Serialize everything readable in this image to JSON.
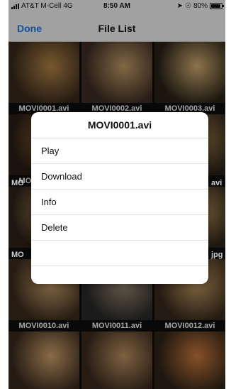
{
  "status_bar": {
    "carrier": "AT&T M-Cell",
    "network": "4G",
    "time": "8:50 AM",
    "battery": "80%"
  },
  "nav": {
    "done_label": "Done",
    "title": "File List"
  },
  "files": [
    {
      "label": "MOVI0001.avi",
      "tone": [
        "#3b2a1c",
        "#b7884a"
      ]
    },
    {
      "label": "MOVI0002.avi",
      "tone": [
        "#3f2e24",
        "#c79f6a"
      ]
    },
    {
      "label": "MOVI0003.avi",
      "tone": [
        "#2a2418",
        "#d7b176"
      ]
    },
    {
      "label": "MOVI0004.avi",
      "tone": [
        "#2a1e14",
        "#9a6d3d"
      ]
    },
    {
      "label": "",
      "tone": [
        "#241a12",
        "#8a6a46"
      ]
    },
    {
      "label": "",
      "tone": [
        "#2a2217",
        "#a48150"
      ]
    },
    {
      "label": "",
      "tone": [
        "#2f2318",
        "#b28a57"
      ]
    },
    {
      "label": "",
      "tone": [
        "#2a2218",
        "#9a7a52"
      ]
    },
    {
      "label": "",
      "tone": [
        "#2c2419",
        "#c3985d"
      ]
    },
    {
      "label": "MOVI0010.avi",
      "tone": [
        "#3b2b1d",
        "#caa16a"
      ]
    },
    {
      "label": "MOVI0011.avi",
      "tone": [
        "#2a2a2a",
        "#9b8a70"
      ]
    },
    {
      "label": "MOVI0012.avi",
      "tone": [
        "#3a2a1d",
        "#c39b63"
      ]
    },
    {
      "label": "",
      "tone": [
        "#3a2a1e",
        "#d3a56f"
      ]
    },
    {
      "label": "",
      "tone": [
        "#3b2b1f",
        "#c39563"
      ]
    },
    {
      "label": "",
      "tone": [
        "#2f2418",
        "#d07c3f"
      ]
    }
  ],
  "peek_labels": {
    "row2_left": "MO",
    "row2_right": "avi",
    "row3_left": "MO",
    "row3_right": "jpg"
  },
  "action_sheet": {
    "title": "MOVI0001.avi",
    "items": [
      "Play",
      "Download",
      "Info",
      "Delete",
      "",
      ""
    ]
  }
}
